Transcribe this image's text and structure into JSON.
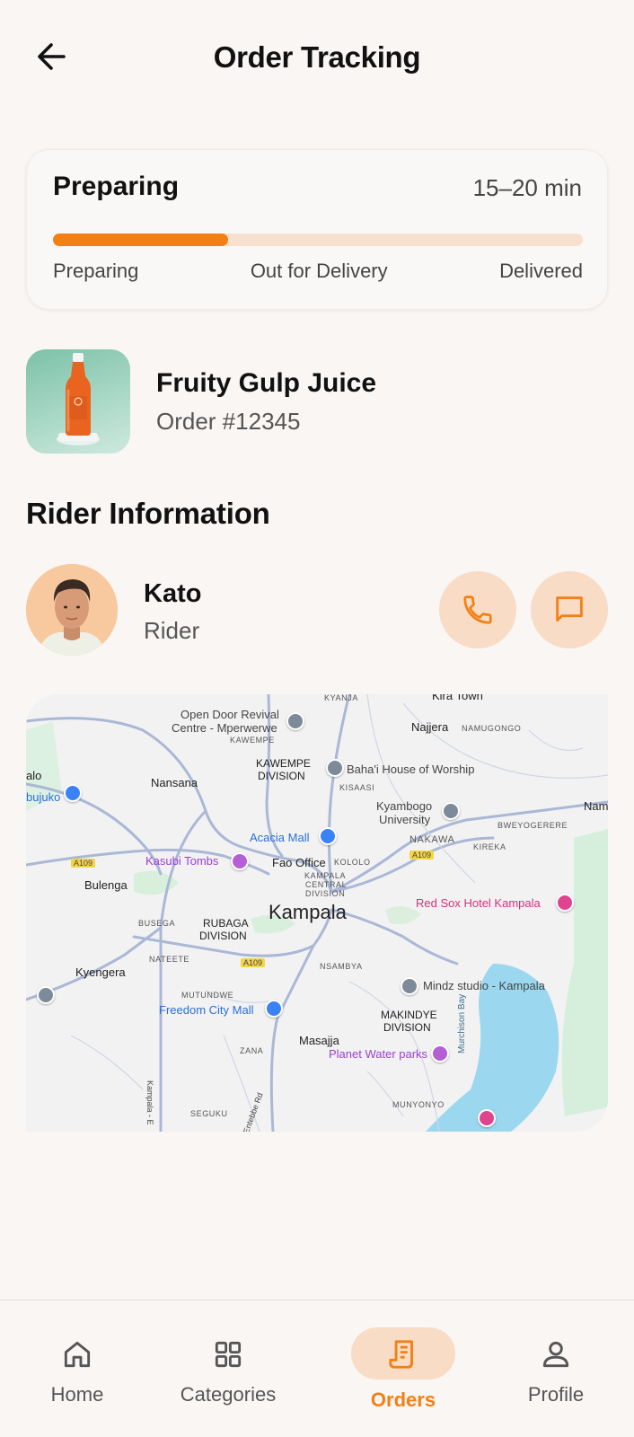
{
  "header": {
    "title": "Order Tracking"
  },
  "status": {
    "title": "Preparing",
    "eta": "15–20 min",
    "progress": 0.33,
    "steps": [
      "Preparing",
      "Out for Delivery",
      "Delivered"
    ]
  },
  "order": {
    "product_name": "Fruity Gulp Juice",
    "order_number": "Order #12345"
  },
  "rider_section": {
    "title": "Rider Information"
  },
  "rider": {
    "name": "Kato",
    "role": "Rider"
  },
  "map": {
    "city": "Kampala",
    "labels": {
      "kyanja": "KYANJA",
      "kira_town": "Kira Town",
      "open_door_1": "Open Door Revival",
      "open_door_2": "Centre - Mperwerwe",
      "kawempe_small": "KAWEMPE",
      "najjera": "Najjera",
      "namugongo": "NAMUGONGO",
      "kawempe_div_1": "KAWEMPE",
      "kawempe_div_2": "DIVISION",
      "bahai": "Baha'i House of Worship",
      "kisaasi": "KISAASI",
      "alo": "alo",
      "bujuko": "bujuko",
      "nansana": "Nansana",
      "kyambogo_1": "Kyambogo",
      "kyambogo_2": "University",
      "nam": "Nam",
      "bweyogerere": "BWEYOGERERE",
      "acacia": "Acacia Mall",
      "nakawa": "NAKAWA",
      "kireka": "KIREKA",
      "a109_1": "A109",
      "kasubi": "Kasubi Tombs",
      "fao": "Fao Office",
      "kololo": "KOLOLO",
      "a109_2": "A109",
      "bulenga": "Bulenga",
      "kampala_central_1": "KAMPALA",
      "kampala_central_2": "CENTRAL",
      "kampala_central_3": "DIVISION",
      "red_sox": "Red Sox Hotel Kampala",
      "busega": "BUSEGA",
      "rubaga_1": "RUBAGA",
      "rubaga_2": "DIVISION",
      "nateete": "NATEETE",
      "a109_3": "A109",
      "nsambya": "NSAMBYA",
      "kyengera": "Kyengera",
      "mindz": "Mindz studio - Kampala",
      "mutundwe": "MUTUNDWE",
      "freedom": "Freedom City Mall",
      "makindye_1": "MAKINDYE",
      "makindye_2": "DIVISION",
      "masajja": "Masajja",
      "zana": "ZANA",
      "planet": "Planet Water parks",
      "murchison": "Murchison Bay",
      "munyonyo": "MUNYONYO",
      "seguku": "SEGUKU",
      "kampala_rd": "Kampala - E",
      "entebbe_rd": "Entebbe Rd"
    }
  },
  "nav": {
    "items": [
      {
        "label": "Home"
      },
      {
        "label": "Categories"
      },
      {
        "label": "Orders"
      },
      {
        "label": "Profile"
      }
    ]
  },
  "colors": {
    "accent": "#f47f14",
    "accent_light": "#f8dcc6",
    "track": "#f7e0cd",
    "background": "#f9f6f4"
  }
}
